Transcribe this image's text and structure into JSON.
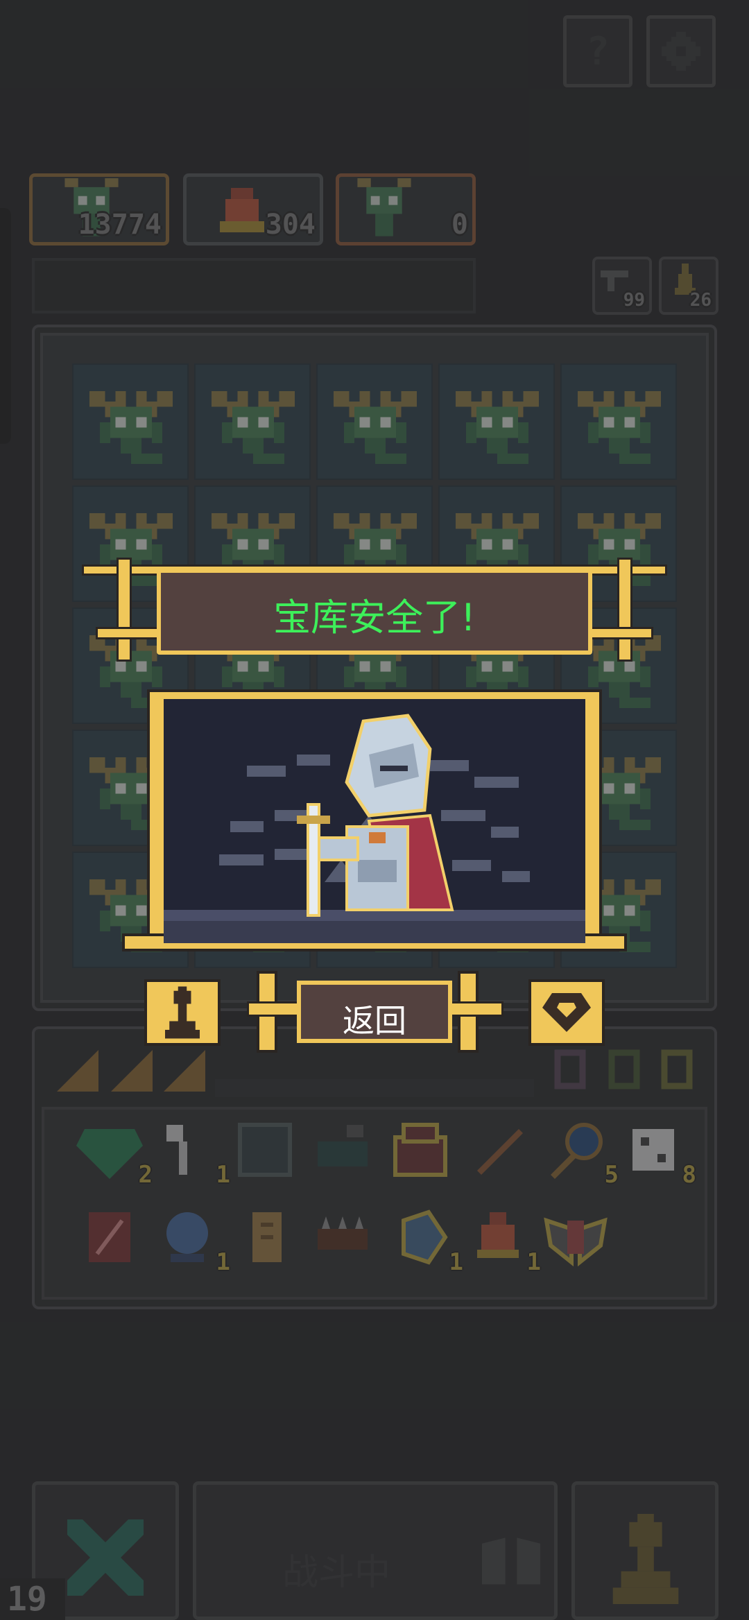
{
  "header": {
    "help_icon": "question-icon",
    "settings_icon": "gear-icon"
  },
  "resources": [
    {
      "name": "dragon",
      "value": "13774"
    },
    {
      "name": "bell",
      "value": "304"
    },
    {
      "name": "dragon-alt",
      "value": "0"
    }
  ],
  "counters": {
    "rewind": "99",
    "hero": "26"
  },
  "popup": {
    "title": "宝库安全了!",
    "back_label": "返回",
    "left_icon": "pawn-icon",
    "right_icon": "gem-icon",
    "title_color": "#3df05a"
  },
  "inventory": {
    "row1": [
      {
        "icon": "emerald-icon",
        "count": "2"
      },
      {
        "icon": "bone-club-icon",
        "count": "1"
      },
      {
        "icon": "carpet-icon",
        "count": ""
      },
      {
        "icon": "cauldron-icon",
        "count": ""
      },
      {
        "icon": "chest-icon",
        "count": ""
      },
      {
        "icon": "stick-icon",
        "count": ""
      },
      {
        "icon": "magnifier-icon",
        "count": "5"
      },
      {
        "icon": "dice-icon",
        "count": "8"
      }
    ],
    "row2": [
      {
        "icon": "scroll-box-icon",
        "count": ""
      },
      {
        "icon": "crystal-ball-icon",
        "count": "1"
      },
      {
        "icon": "parchment-icon",
        "count": ""
      },
      {
        "icon": "spiked-log-icon",
        "count": ""
      },
      {
        "icon": "stone-icon",
        "count": "1"
      },
      {
        "icon": "bell-icon",
        "count": "1"
      },
      {
        "icon": "winged-shield-icon",
        "count": ""
      }
    ]
  },
  "bottom": {
    "battle_label": "战斗中",
    "level": "19"
  }
}
